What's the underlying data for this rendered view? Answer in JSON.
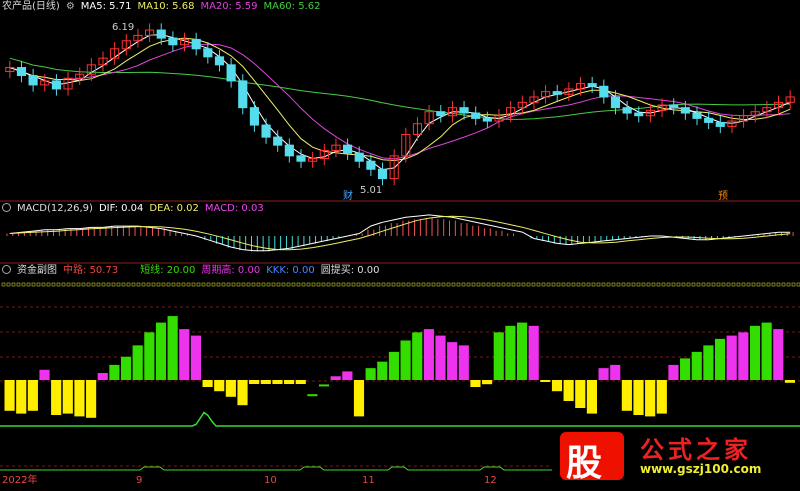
{
  "header": {
    "title": "农产品(日线)",
    "ma5": "MA5: 5.71",
    "ma10": "MA10: 5.68",
    "ma20": "MA20: 5.59",
    "ma60": "MA60: 5.62",
    "high_mark": "6.19",
    "low_mark": "5.01",
    "tag_cai": "财",
    "tag_yu": "预"
  },
  "macd": {
    "title": "MACD(12,26,9)",
    "dif": "DIF: 0.04",
    "dea": "DEA: 0.02",
    "macd": "MACD: 0.03"
  },
  "fund": {
    "title": "资金副图",
    "zhonglu": "中路: 50.73",
    "duanxian": "短线: 20.00",
    "zhoudi": "周期高: 0.00",
    "kkk": "KKK: 0.00",
    "tuimai": "圆提买: 0.00"
  },
  "xaxis": {
    "year": "2022年",
    "m9": "9",
    "m10": "10",
    "m11": "11",
    "m12": "12"
  },
  "watermark": {
    "char": "股",
    "title": "公式之家",
    "url": "www.gszj100.com"
  },
  "colors": {
    "bg": "#000000",
    "up": "#ff3333",
    "down": "#55ddee",
    "ma5": "#ffffff",
    "ma10": "#eeee66",
    "ma20": "#dd44dd",
    "ma60": "#44cc44",
    "bar_green": "#33dd00",
    "bar_magenta": "#ee33ee",
    "bar_yellow": "#ffee00"
  },
  "chart_data": [
    {
      "type": "candlestick",
      "title": "农产品(日线)",
      "x_ticks": [
        "2022年",
        "9",
        "10",
        "11",
        "12"
      ],
      "series": [
        {
          "name": "MA5",
          "value": 5.71
        },
        {
          "name": "MA10",
          "value": 5.68
        },
        {
          "name": "MA20",
          "value": 5.59
        },
        {
          "name": "MA60",
          "value": 5.62
        }
      ],
      "annotations": {
        "high": 6.19,
        "low": 5.01
      },
      "closes": [
        5.88,
        5.82,
        5.75,
        5.78,
        5.72,
        5.8,
        5.83,
        5.9,
        5.95,
        6.02,
        6.08,
        6.12,
        6.16,
        6.1,
        6.05,
        6.09,
        6.02,
        5.96,
        5.9,
        5.78,
        5.58,
        5.45,
        5.36,
        5.3,
        5.22,
        5.18,
        5.2,
        5.26,
        5.3,
        5.24,
        5.18,
        5.12,
        5.05,
        5.22,
        5.38,
        5.46,
        5.55,
        5.52,
        5.58,
        5.54,
        5.5,
        5.48,
        5.52,
        5.58,
        5.62,
        5.66,
        5.7,
        5.68,
        5.72,
        5.76,
        5.74,
        5.66,
        5.58,
        5.54,
        5.52,
        5.56,
        5.6,
        5.58,
        5.54,
        5.5,
        5.47,
        5.44,
        5.48,
        5.52,
        5.55,
        5.58,
        5.62,
        5.66
      ]
    },
    {
      "type": "line",
      "title": "MACD(12,26,9)",
      "series": [
        {
          "name": "DIF",
          "value": 0.04
        },
        {
          "name": "DEA",
          "value": 0.02
        },
        {
          "name": "MACD",
          "value": 0.03
        }
      ],
      "histogram": [
        0.02,
        0.03,
        0.04,
        0.05,
        0.05,
        0.06,
        0.06,
        0.07,
        0.07,
        0.08,
        0.08,
        0.08,
        0.07,
        0.06,
        0.04,
        0.02,
        0.0,
        -0.03,
        -0.06,
        -0.09,
        -0.11,
        -0.12,
        -0.12,
        -0.11,
        -0.1,
        -0.08,
        -0.06,
        -0.04,
        -0.02,
        0.0,
        0.02,
        0.05,
        0.08,
        0.1,
        0.12,
        0.13,
        0.14,
        0.13,
        0.12,
        0.1,
        0.08,
        0.06,
        0.04,
        0.02,
        0.0,
        -0.02,
        -0.04,
        -0.06,
        -0.07,
        -0.06,
        -0.05,
        -0.04,
        -0.03,
        -0.02,
        -0.01,
        0.0,
        0.0,
        -0.01,
        -0.02,
        -0.03,
        -0.03,
        -0.02,
        -0.01,
        0.0,
        0.01,
        0.02,
        0.03,
        0.03
      ]
    },
    {
      "type": "bar",
      "title": "资金副图",
      "series": [
        {
          "name": "中路",
          "value": 50.73
        },
        {
          "name": "短线",
          "value": 20.0
        },
        {
          "name": "周期高",
          "value": 0.0
        },
        {
          "name": "KKK",
          "value": 0.0
        },
        {
          "name": "圆提买",
          "value": 0.0
        }
      ],
      "bars": [
        {
          "v": 38,
          "c": "y"
        },
        {
          "v": 36,
          "c": "y"
        },
        {
          "v": 38,
          "c": "y"
        },
        {
          "v": 37,
          "c": "m"
        },
        {
          "v": 35,
          "c": "y"
        },
        {
          "v": 36,
          "c": "y"
        },
        {
          "v": 34,
          "c": "y"
        },
        {
          "v": 33,
          "c": "y"
        },
        {
          "v": 35,
          "c": "m"
        },
        {
          "v": 40,
          "c": "g"
        },
        {
          "v": 45,
          "c": "g"
        },
        {
          "v": 52,
          "c": "g"
        },
        {
          "v": 60,
          "c": "g"
        },
        {
          "v": 66,
          "c": "g"
        },
        {
          "v": 70,
          "c": "g"
        },
        {
          "v": 62,
          "c": "m"
        },
        {
          "v": 58,
          "c": "m"
        },
        {
          "v": 55,
          "c": "y"
        },
        {
          "v": 52,
          "c": "y"
        },
        {
          "v": 48,
          "c": "y"
        },
        {
          "v": 42,
          "c": "y"
        },
        {
          "v": 30,
          "c": "y"
        },
        {
          "v": 20,
          "c": "y"
        },
        {
          "v": 14,
          "c": "y"
        },
        {
          "v": 12,
          "c": "y"
        },
        {
          "v": 16,
          "c": "y"
        },
        {
          "v": 22,
          "c": "g"
        },
        {
          "v": 28,
          "c": "g"
        },
        {
          "v": 33,
          "c": "m"
        },
        {
          "v": 36,
          "c": "m"
        },
        {
          "v": 34,
          "c": "y"
        },
        {
          "v": 38,
          "c": "g"
        },
        {
          "v": 42,
          "c": "g"
        },
        {
          "v": 48,
          "c": "g"
        },
        {
          "v": 55,
          "c": "g"
        },
        {
          "v": 60,
          "c": "g"
        },
        {
          "v": 62,
          "c": "m"
        },
        {
          "v": 58,
          "c": "m"
        },
        {
          "v": 54,
          "c": "m"
        },
        {
          "v": 52,
          "c": "m"
        },
        {
          "v": 55,
          "c": "y"
        },
        {
          "v": 57,
          "c": "y"
        },
        {
          "v": 60,
          "c": "g"
        },
        {
          "v": 64,
          "c": "g"
        },
        {
          "v": 66,
          "c": "g"
        },
        {
          "v": 64,
          "c": "m"
        },
        {
          "v": 60,
          "c": "y"
        },
        {
          "v": 52,
          "c": "y"
        },
        {
          "v": 45,
          "c": "y"
        },
        {
          "v": 40,
          "c": "y"
        },
        {
          "v": 36,
          "c": "y"
        },
        {
          "v": 38,
          "c": "m"
        },
        {
          "v": 40,
          "c": "m"
        },
        {
          "v": 38,
          "c": "y"
        },
        {
          "v": 35,
          "c": "y"
        },
        {
          "v": 34,
          "c": "y"
        },
        {
          "v": 36,
          "c": "y"
        },
        {
          "v": 40,
          "c": "m"
        },
        {
          "v": 44,
          "c": "g"
        },
        {
          "v": 48,
          "c": "g"
        },
        {
          "v": 52,
          "c": "g"
        },
        {
          "v": 56,
          "c": "g"
        },
        {
          "v": 58,
          "c": "m"
        },
        {
          "v": 60,
          "c": "m"
        },
        {
          "v": 64,
          "c": "g"
        },
        {
          "v": 66,
          "c": "g"
        },
        {
          "v": 62,
          "c": "m"
        },
        {
          "v": 58,
          "c": "y"
        }
      ]
    }
  ]
}
